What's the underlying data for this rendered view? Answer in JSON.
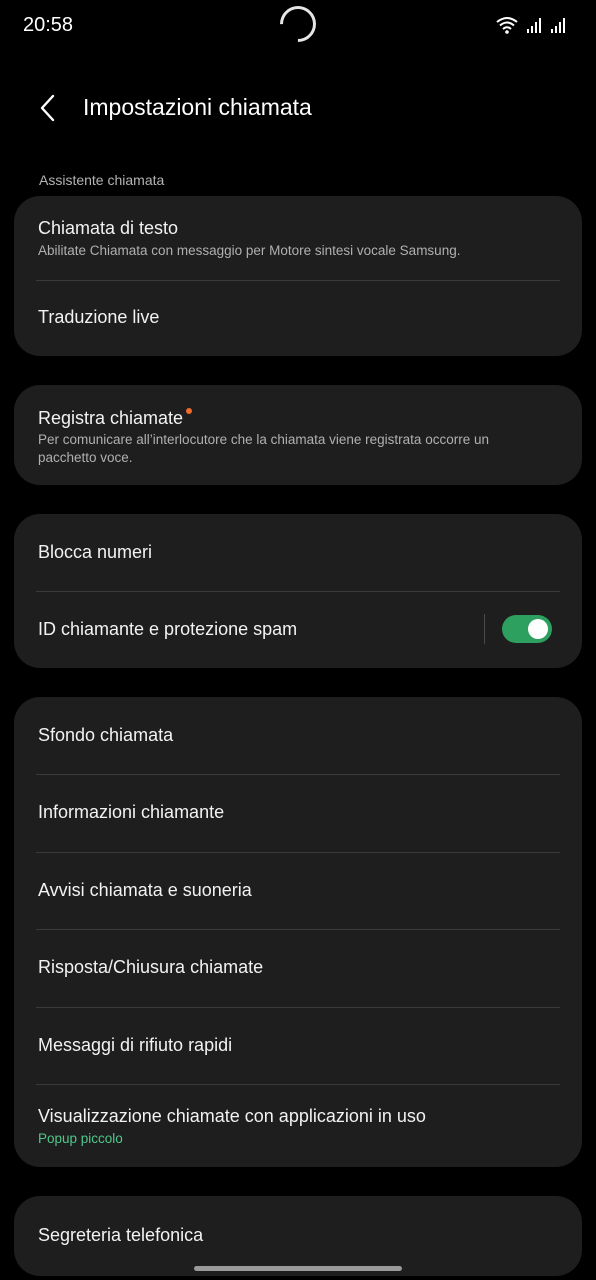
{
  "status_bar": {
    "time": "20:58",
    "icons": [
      "wifi-icon",
      "signal-icon",
      "signal-icon"
    ]
  },
  "header": {
    "back_icon": "chevron-left-icon",
    "title": "Impostazioni chiamata"
  },
  "section": {
    "assistant_label": "Assistente chiamata"
  },
  "group1": {
    "text_call": {
      "title": "Chiamata di testo",
      "subtitle": "Abilitate Chiamata con messaggio per Motore sintesi vocale Samsung."
    },
    "live_translate": {
      "title": "Traduzione live"
    }
  },
  "group2": {
    "record_calls": {
      "title": "Registra chiamate",
      "subtitle": "Per comunicare all’interlocutore che la chiamata viene registrata occorre un pacchetto voce."
    }
  },
  "group3": {
    "block_numbers": {
      "title": "Blocca numeri"
    },
    "caller_id": {
      "title": "ID chiamante e protezione spam",
      "toggle_on": true
    }
  },
  "group4": {
    "call_background": {
      "title": "Sfondo chiamata"
    },
    "caller_info": {
      "title": "Informazioni chiamante"
    },
    "call_alerts": {
      "title": "Avvisi chiamata e suoneria"
    },
    "answer_end": {
      "title": "Risposta/Chiusura chiamate"
    },
    "quick_decline": {
      "title": "Messaggi di rifiuto rapidi"
    },
    "calls_in_apps": {
      "title": "Visualizzazione chiamate con applicazioni in uso",
      "subtitle": "Popup piccolo"
    }
  },
  "group5": {
    "voicemail": {
      "title": "Segreteria telefonica"
    }
  },
  "colors": {
    "background": "#000000",
    "card": "#1e1e1e",
    "accent_green": "#2d9f5e",
    "subtitle_green": "#4fc78a",
    "badge_orange": "#f06b2c"
  }
}
